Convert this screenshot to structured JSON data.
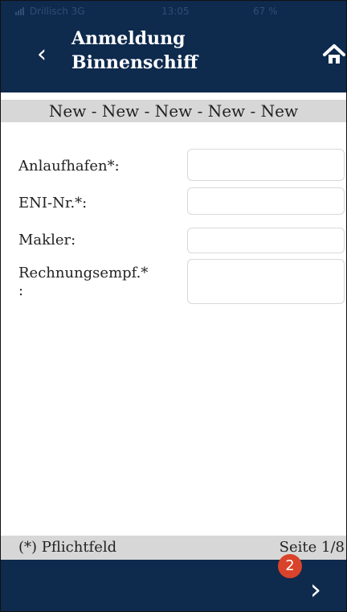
{
  "status_bar": {
    "carrier": "Drillisch  3G",
    "time": "13:05",
    "battery": "67 %"
  },
  "header": {
    "title": "Anmeldung\nBinnenschiff",
    "back_icon": "chevron-left-icon",
    "home_icon": "home-icon"
  },
  "subheader": {
    "text": "New - New - New - New - New"
  },
  "form": {
    "fields": [
      {
        "label": "Anlaufhafen*:",
        "value": ""
      },
      {
        "label": "ENI-Nr.*:",
        "value": ""
      },
      {
        "label": "Makler:",
        "value": ""
      },
      {
        "label": "Rechnungsempf.*\n:",
        "value": ""
      }
    ]
  },
  "footer": {
    "required_note": "(*) Pflichtfeld",
    "page_indicator": "Seite 1/8"
  },
  "bottom_nav": {
    "badge_count": "2",
    "next_icon": "chevron-right-icon"
  },
  "colors": {
    "primary": "#0e2a4d",
    "subheader_bg": "#d7d7d7",
    "badge": "#d9432b"
  }
}
